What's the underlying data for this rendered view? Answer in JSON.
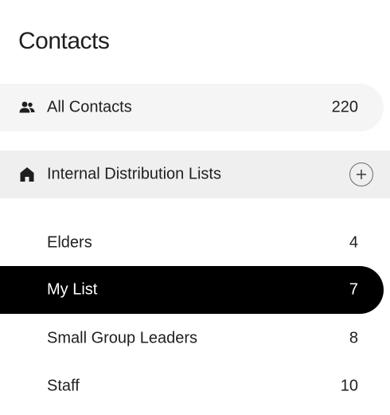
{
  "header": {
    "title": "Contacts"
  },
  "all_contacts": {
    "label": "All Contacts",
    "count": "220",
    "icon": "people-icon"
  },
  "section": {
    "label": "Internal Distribution Lists",
    "icon": "home-icon",
    "add_icon": "plus-circle-icon"
  },
  "lists": [
    {
      "label": "Elders",
      "count": "4",
      "selected": false
    },
    {
      "label": "My List",
      "count": "7",
      "selected": true
    },
    {
      "label": "Small Group Leaders",
      "count": "8",
      "selected": false
    },
    {
      "label": "Staff",
      "count": "10",
      "selected": false
    }
  ],
  "colors": {
    "selected_bg": "#000000",
    "selected_text": "#ffffff",
    "all_contacts_bg": "#f5f5f5",
    "section_bg": "#efefef"
  }
}
